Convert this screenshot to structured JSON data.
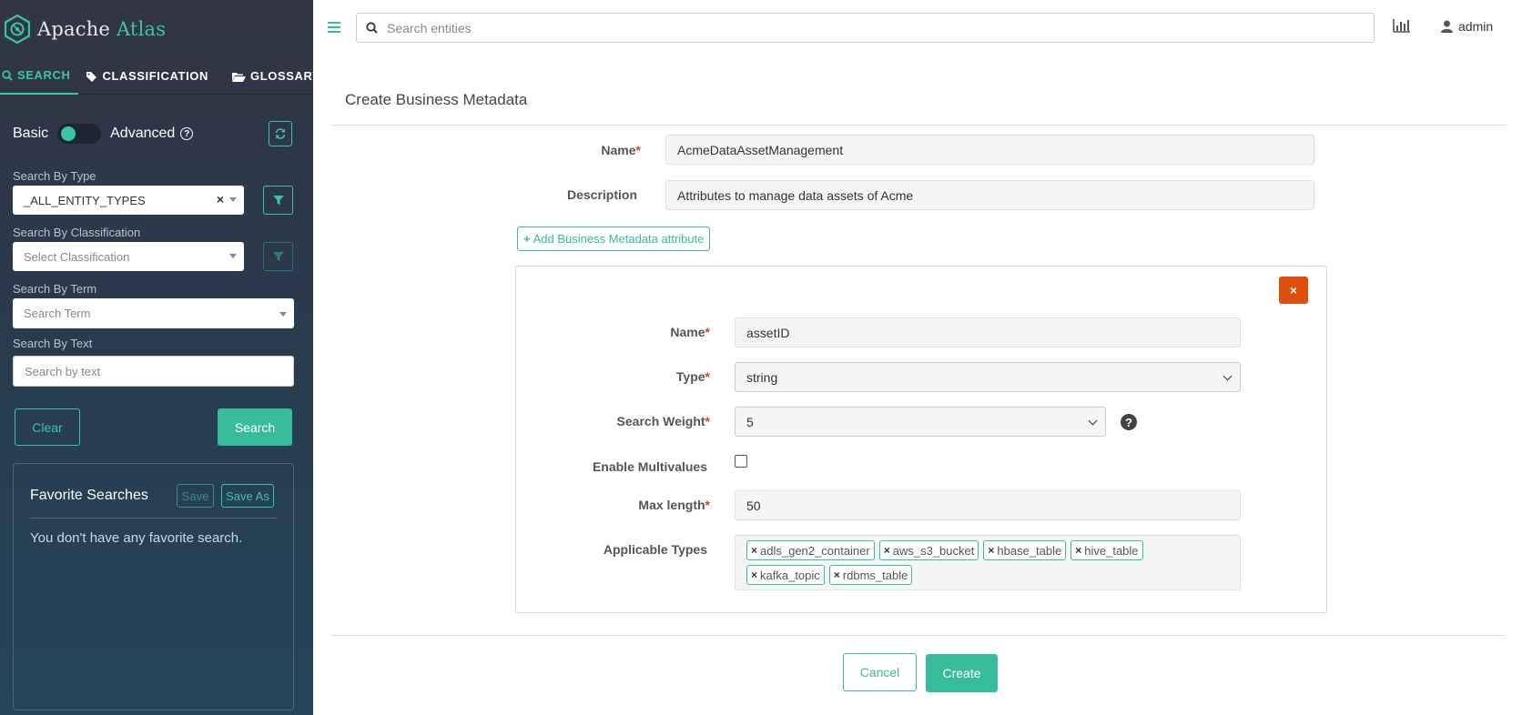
{
  "colors": {
    "accent": "#37bb9b",
    "danger": "#e04e0c",
    "sidebar_bg": "#2a3a4c",
    "required": "#e53935"
  },
  "brand": {
    "name_part1": "Apache",
    "name_part2": "Atlas"
  },
  "sidebar": {
    "tabs": [
      {
        "label": "SEARCH",
        "icon": "search-icon",
        "active": true
      },
      {
        "label": "CLASSIFICATION",
        "icon": "tags-icon",
        "active": false
      },
      {
        "label": "GLOSSARY",
        "icon": "folder-open-icon",
        "active": false
      }
    ],
    "toggle": {
      "left_label": "Basic",
      "right_label": "Advanced"
    },
    "type": {
      "label": "Search By Type",
      "value": "_ALL_ENTITY_TYPES"
    },
    "classification": {
      "label": "Search By Classification",
      "placeholder": "Select Classification"
    },
    "term": {
      "label": "Search By Term",
      "placeholder": "Search Term"
    },
    "text": {
      "label": "Search By Text",
      "placeholder": "Search by text"
    },
    "clear_label": "Clear",
    "search_label": "Search",
    "favorites": {
      "title": "Favorite Searches",
      "save_label": "Save",
      "save_as_label": "Save As",
      "empty_text": "You don't have any favorite search."
    }
  },
  "topbar": {
    "search_placeholder": "Search entities",
    "user": "admin"
  },
  "form": {
    "title": "Create Business Metadata",
    "name": {
      "label": "Name",
      "value": "AcmeDataAssetManagement"
    },
    "description": {
      "label": "Description",
      "value": "Attributes to manage data assets of Acme"
    },
    "add_attribute_label": "Add Business Metadata attribute",
    "attribute": {
      "name": {
        "label": "Name",
        "value": "assetID"
      },
      "type": {
        "label": "Type",
        "value": "string"
      },
      "search_weight": {
        "label": "Search Weight",
        "value": "5"
      },
      "multivalues": {
        "label": "Enable Multivalues",
        "checked": false
      },
      "max_length": {
        "label": "Max length",
        "value": "50"
      },
      "applicable_types": {
        "label": "Applicable Types",
        "tags": [
          "adls_gen2_container",
          "aws_s3_bucket",
          "hbase_table",
          "hive_table",
          "kafka_topic",
          "rdbms_table"
        ]
      }
    },
    "cancel_label": "Cancel",
    "create_label": "Create"
  }
}
